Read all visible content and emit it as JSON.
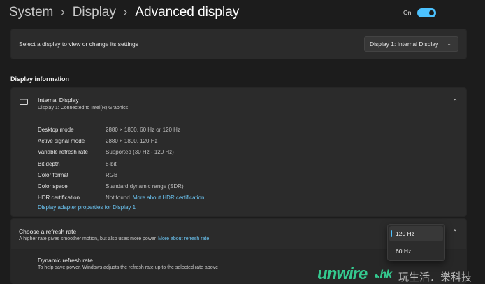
{
  "breadcrumb": {
    "items": [
      "System",
      "Display",
      "Advanced display"
    ],
    "separator": "›"
  },
  "display_select": {
    "label": "Select a display to view or change its settings",
    "value": "Display 1: Internal Display",
    "chevron_icon": "chevron-down-icon"
  },
  "section_title": "Display information",
  "info": {
    "name": "Internal Display",
    "subtitle": "Display 1: Connected to Intel(R) Graphics",
    "icon": "monitor-icon",
    "collapse_icon": "chevron-up-icon",
    "properties": [
      {
        "key": "Desktop mode",
        "value": "2880 × 1800, 60 Hz or 120 Hz"
      },
      {
        "key": "Active signal mode",
        "value": "2880 × 1800, 120 Hz"
      },
      {
        "key": "Variable refresh rate",
        "value": "Supported (30 Hz - 120 Hz)"
      },
      {
        "key": "Bit depth",
        "value": "8-bit"
      },
      {
        "key": "Color format",
        "value": "RGB"
      },
      {
        "key": "Color space",
        "value": "Standard dynamic range (SDR)"
      },
      {
        "key": "HDR certification",
        "value": "Not found",
        "link": "More about HDR certification"
      }
    ],
    "adapter_link": "Display adapter properties for Display 1"
  },
  "refresh": {
    "title": "Choose a refresh rate",
    "desc": "A higher rate gives smoother motion, but also uses more power",
    "link": "More about refresh rate",
    "options": [
      "120 Hz",
      "60 Hz"
    ],
    "selected": "120 Hz"
  },
  "dynamic": {
    "title": "Dynamic refresh rate",
    "desc": "To help save power, Windows adjusts the refresh rate up to the selected rate above",
    "state": "On"
  },
  "watermark": {
    "logo": "unwire",
    "suffix": ".hk",
    "text": "玩生活．樂科技"
  },
  "colors": {
    "accent": "#4cc2ff",
    "link": "#6cc6f4",
    "background": "#1c1c1c",
    "card": "#2b2b2b"
  }
}
